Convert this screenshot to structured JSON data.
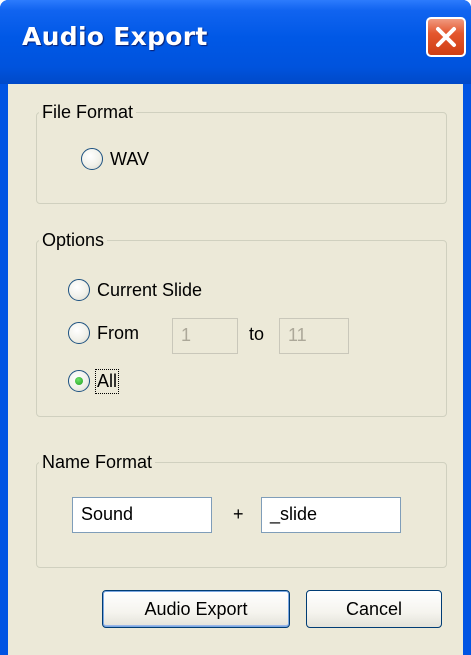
{
  "window": {
    "title": "Audio Export"
  },
  "file_format": {
    "legend": "File Format",
    "options": [
      {
        "label": "WAV",
        "selected": false
      }
    ]
  },
  "options": {
    "legend": "Options",
    "current_slide": {
      "label": "Current Slide",
      "selected": false
    },
    "from": {
      "label": "From",
      "selected": false,
      "from_value": "1",
      "to_label": "to",
      "to_value": "11"
    },
    "all": {
      "label": "All",
      "selected": true
    }
  },
  "name_format": {
    "legend": "Name Format",
    "prefix_value": "Sound",
    "plus": "+",
    "suffix_value": "_slide"
  },
  "buttons": {
    "export": "Audio Export",
    "cancel": "Cancel"
  },
  "icons": {
    "close": "close-icon"
  },
  "colors": {
    "titlebar": "#0058e6",
    "close_button": "#e4572e",
    "dialog_bg": "#ece9d8"
  }
}
